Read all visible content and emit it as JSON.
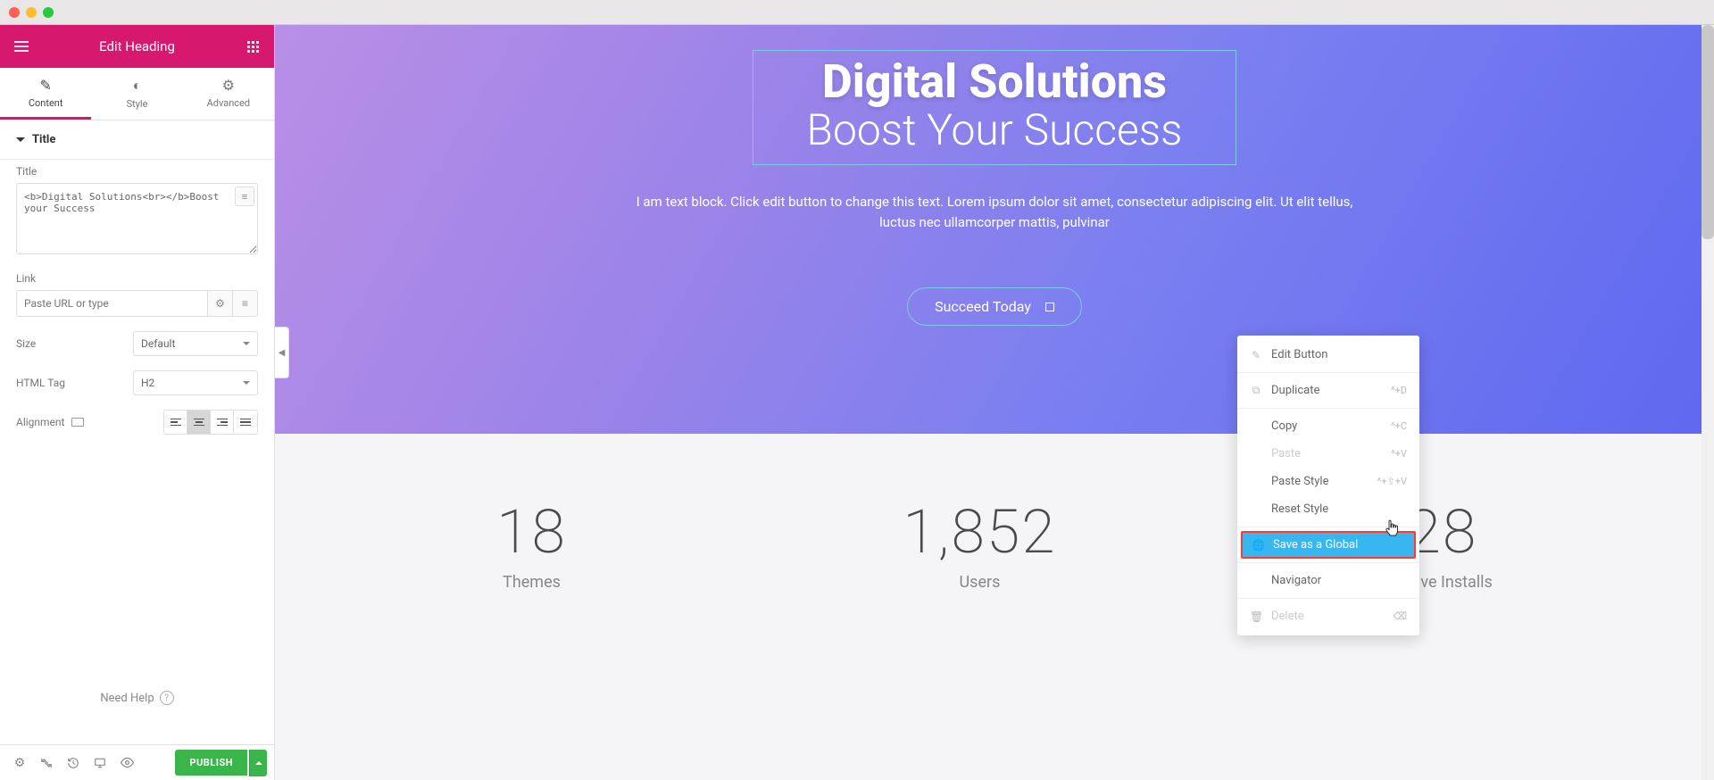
{
  "header": {
    "title": "Edit Heading"
  },
  "tabs": [
    {
      "label": "Content",
      "active": true
    },
    {
      "label": "Style",
      "active": false
    },
    {
      "label": "Advanced",
      "active": false
    }
  ],
  "section": {
    "title": "Title"
  },
  "fields": {
    "title_label": "Title",
    "title_value": "<b>Digital Solutions<br></b>Boost your Success",
    "link_label": "Link",
    "link_placeholder": "Paste URL or type",
    "size_label": "Size",
    "size_value": "Default",
    "htmltag_label": "HTML Tag",
    "htmltag_value": "H2",
    "alignment_label": "Alignment"
  },
  "need_help": "Need Help",
  "publish": "PUBLISH",
  "hero": {
    "heading_bold": "Digital Solutions",
    "heading_light": "Boost Your Success",
    "paragraph": "I am text block. Click edit button to change this text. Lorem ipsum dolor sit amet, consectetur adipiscing elit. Ut elit tellus, luctus nec ullamcorper mattis, pulvinar",
    "button": "Succeed Today"
  },
  "stats": [
    {
      "number": "18",
      "label": "Themes"
    },
    {
      "number": "1,852",
      "label": "Users"
    },
    {
      "number": "28",
      "label": "Active Installs"
    }
  ],
  "context_menu": {
    "edit": "Edit Button",
    "duplicate": "Duplicate",
    "duplicate_sc": "^+D",
    "copy": "Copy",
    "copy_sc": "^+C",
    "paste": "Paste",
    "paste_sc": "^+V",
    "paste_style": "Paste Style",
    "paste_style_sc": "^+⇧+V",
    "reset_style": "Reset Style",
    "save_global": "Save as a Global",
    "navigator": "Navigator",
    "delete": "Delete"
  },
  "colors": {
    "brand": "#d6186f",
    "accent": "#39b54a",
    "highlight": "#37b6f0"
  }
}
